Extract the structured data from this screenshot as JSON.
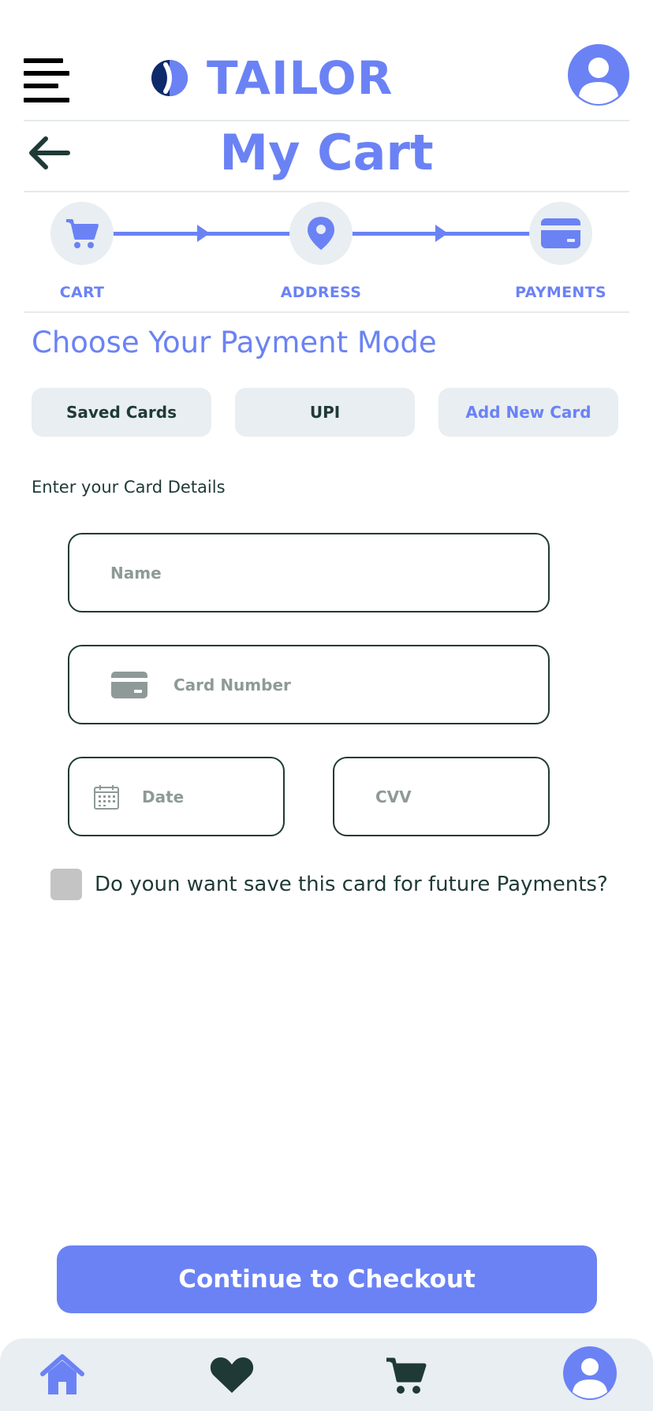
{
  "app": {
    "brand": "TAILOR"
  },
  "header": {
    "title": "My Cart"
  },
  "stepper": {
    "steps": [
      {
        "label": "CART",
        "icon": "cart-icon"
      },
      {
        "label": "ADDRESS",
        "icon": "location-pin-icon"
      },
      {
        "label": "PAYMENTS",
        "icon": "credit-card-icon"
      }
    ]
  },
  "payment": {
    "section_title": "Choose Your Payment Mode",
    "tabs": [
      {
        "label": "Saved  Cards",
        "active": false
      },
      {
        "label": "UPI",
        "active": false
      },
      {
        "label": "Add New Card",
        "active": true
      }
    ],
    "details_label": "Enter your Card Details",
    "fields": {
      "name_placeholder": "Name",
      "card_number_placeholder": "Card Number",
      "date_placeholder": "Date",
      "cvv_placeholder": "CVV"
    },
    "save_card_text": "Do youn want save this card for future Payments?",
    "save_card_checked": false
  },
  "checkout": {
    "label": "Continue to Checkout"
  },
  "bottom_nav": [
    "home-icon",
    "heart-icon",
    "cart-icon",
    "profile-icon"
  ],
  "colors": {
    "accent": "#6b82f5",
    "dark": "#1f3a36",
    "surface": "#e8eef2"
  }
}
